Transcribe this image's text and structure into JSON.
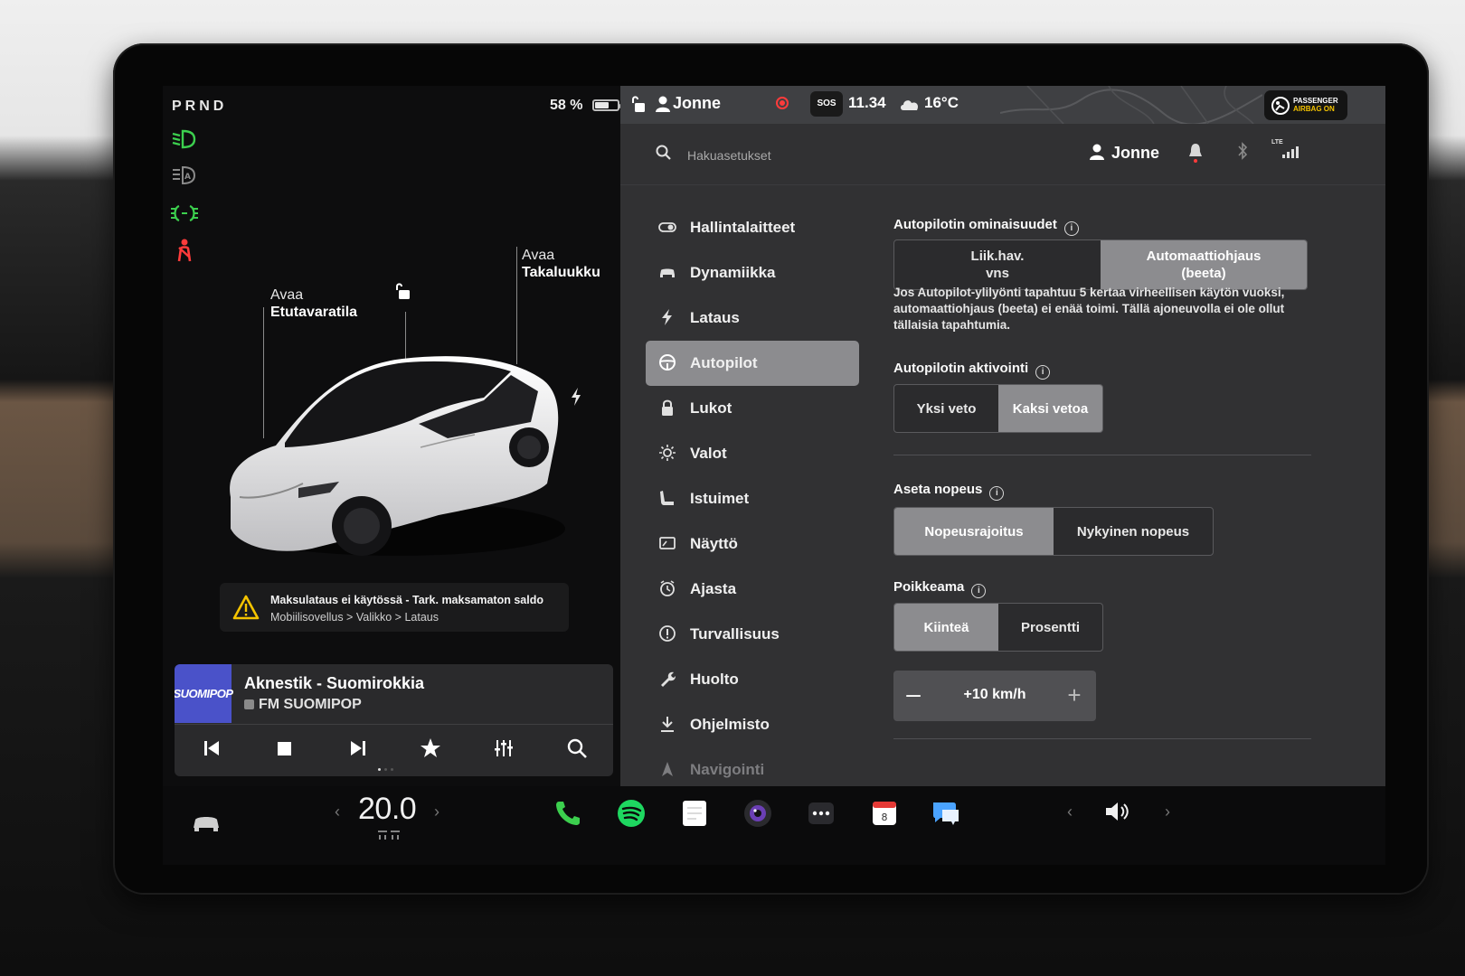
{
  "left": {
    "gear": "PRND",
    "battery_percent": "58 %",
    "battery_level": 0.58,
    "callouts": {
      "frunk_line1": "Avaa",
      "frunk_line2": "Etutavaratila",
      "trunk_line1": "Avaa",
      "trunk_line2": "Takaluukku"
    },
    "alert": {
      "title": "Maksulataus ei käytössä - Tark. maksamaton saldo",
      "path": "Mobiilisovellus > Valikko > Lataus"
    },
    "media": {
      "logo_text": "SUOMIPOP",
      "song": "Aknestik - Suomirokkia",
      "station": "FM SUOMIPOP"
    }
  },
  "statusbar": {
    "user": "Jonne",
    "sos": "SOS",
    "time": "11.34",
    "temperature": "16°C",
    "airbag_line1": "PASSENGER",
    "airbag_line2": "AIRBAG ON"
  },
  "search": {
    "placeholder": "Hakuasetukset",
    "user": "Jonne",
    "lte": "LTE"
  },
  "nav": {
    "items": [
      {
        "label": "Hallintalaitteet"
      },
      {
        "label": "Dynamiikka"
      },
      {
        "label": "Lataus"
      },
      {
        "label": "Autopilot"
      },
      {
        "label": "Lukot"
      },
      {
        "label": "Valot"
      },
      {
        "label": "Istuimet"
      },
      {
        "label": "Näyttö"
      },
      {
        "label": "Ajasta"
      },
      {
        "label": "Turvallisuus"
      },
      {
        "label": "Huolto"
      },
      {
        "label": "Ohjelmisto"
      },
      {
        "label": "Navigointi"
      }
    ],
    "active": "Autopilot"
  },
  "autopilot": {
    "features_title": "Autopilotin ominaisuudet",
    "features_options": [
      "Liik.hav. vns",
      "Automaattiohjaus (beeta)"
    ],
    "features_option_a": "Liik.hav.",
    "features_option_a2": "vns",
    "features_option_b": "Automaattiohjaus",
    "features_option_b2": "(beeta)",
    "features_selected": "Automaattiohjaus (beeta)",
    "description": "Jos Autopilot-ylilyönti tapahtuu 5 kertaa virheellisen käytön vuoksi, automaattiohjaus (beeta) ei enää toimi. Tällä ajoneuvolla ei ole ollut tällaisia tapahtumia.",
    "activation_title": "Autopilotin aktivointi",
    "activation_options": [
      "Yksi veto",
      "Kaksi vetoa"
    ],
    "activation_selected": "Kaksi vetoa",
    "speed_title": "Aseta nopeus",
    "speed_options": [
      "Nopeusrajoitus",
      "Nykyinen nopeus"
    ],
    "speed_selected": "Nopeusrajoitus",
    "offset_title": "Poikkeama",
    "offset_options": [
      "Kiinteä",
      "Prosentti"
    ],
    "offset_selected": "Kiinteä",
    "offset_value": "+10 km/h"
  },
  "dock": {
    "cabin_temp": "20.0"
  },
  "colors": {
    "accent_green": "#3ccf4e",
    "alert_red": "#ff3b3b",
    "selected_segment": "#8c8c8f",
    "panel_bg": "#313133"
  }
}
